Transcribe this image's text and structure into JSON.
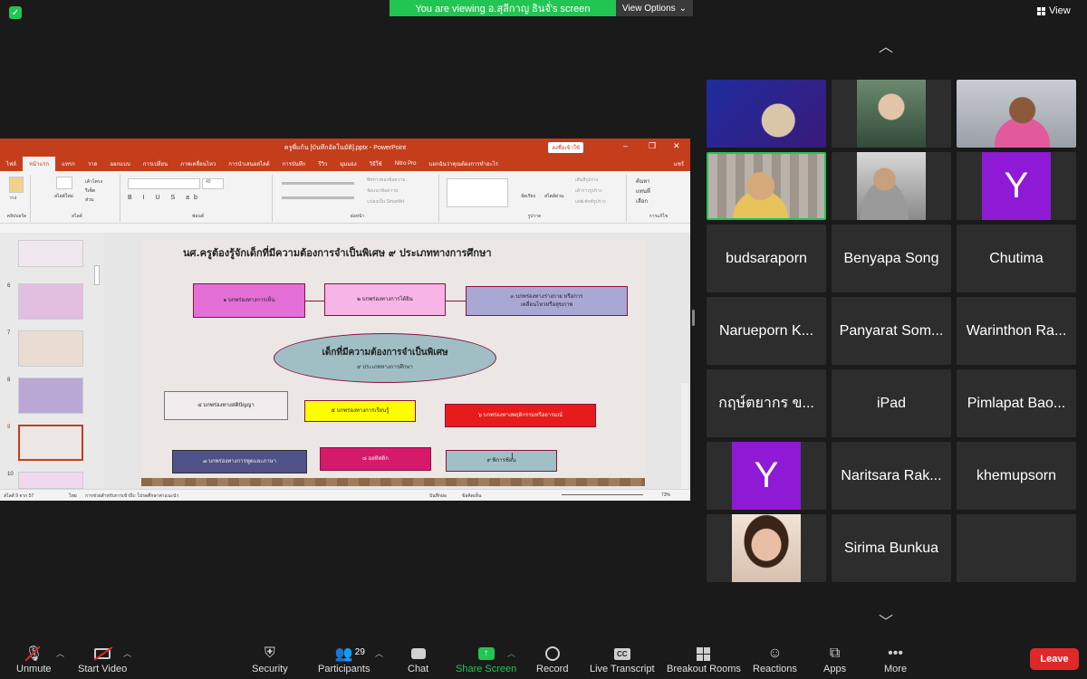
{
  "top": {
    "banner": "You are viewing อ.สุลีกาญ ธินจั่'s screen",
    "view_options": "View Options",
    "view": "View"
  },
  "ppt": {
    "title": "ครูพี่แก้น [บันทึกอัตโนมัติ].pptx - PowerPoint",
    "signin": "ลงชื่อเข้าใช้",
    "tabs": [
      "ไฟล์",
      "หน้าแรก",
      "แทรก",
      "วาด",
      "ออกแบบ",
      "การเปลี่ยน",
      "ภาพเคลื่อนไหว",
      "การนำเสนอสไลด์",
      "การบันทึก",
      "รีวิว",
      "มุมมอง",
      "วิธีใช้",
      "Nitro Pro",
      "บอกฉันว่าคุณต้องการทำอะไร",
      "แชร์"
    ],
    "active_tab_index": 1,
    "ribbon_groups": [
      "คลิปบอร์ด",
      "สไลด์",
      "ฟอนต์",
      "ย่อหน้า",
      "รูปวาด",
      "การแก้ไข"
    ],
    "ribbon_items": {
      "paste": "วาง",
      "new_slide": "สไลด์ใหม่",
      "layout": "เค้าโครง",
      "reset": "รีเซ็ต",
      "section": "ส่วน",
      "font_size": "40",
      "text_direction": "ทิศทางของข้อความ",
      "align_text": "จัดแนวข้อความ",
      "smartart": "แปลงเป็น SmartArt",
      "arrange": "จัดเรียง",
      "quick_styles": "สไตล์ด่วน",
      "shape_fill": "เติมสีรูปร่าง",
      "shape_outline": "เค้าร่างรูปร่าง",
      "shape_effects": "เอฟเฟกต์รูปร่าง",
      "find": "ค้นหา",
      "replace": "แทนที่",
      "select": "เลือก"
    },
    "thumb_numbers": [
      "6",
      "7",
      "8",
      "9",
      "10"
    ],
    "status": {
      "slide": "สไลด์ 9 จาก 57",
      "language": "ไทย",
      "accessibility": "การช่วยสำหรับการเข้าถึง: โปรดศึกษาค่าแนะนำ",
      "notes": "บันทึกย่อ",
      "comments": "ข้อคิดเห็น",
      "zoom": "73%"
    }
  },
  "slide": {
    "title": "นศ.ครูต้องรู้จักเด็กที่มีความต้องการจำเป็นพิเศษ ๙ ประเภททางการศึกษา",
    "center_main": "เด็กที่มีความต้องการจำเป็นพิเศษ",
    "center_sub": "๙ ประเภททางการศึกษา",
    "boxes": [
      {
        "text": "๑ บกพร่องทางการเห็น",
        "color": "#e46fd7"
      },
      {
        "text": "๒ บกพร่องทางการได้ยิน",
        "color": "#f7b4e6"
      },
      {
        "text": "๓ บกพร่องทางร่างกาย หรือการเคลื่อนไหวหรือสุขภาพ",
        "color": "#a9a8d4"
      },
      {
        "text": "๔ บกพร่องทางสติปัญญา",
        "color": "#f2ecee"
      },
      {
        "text": "๕ บกพร่องทางการเรียนรู้",
        "color": "#ffff00"
      },
      {
        "text": "๖ บกพร่องทางพฤติกรรมหรืออารมณ์",
        "color": "#e81b1b"
      },
      {
        "text": "๗ บกพร่องทางการพูดและภาษา",
        "color": "#4f5289"
      },
      {
        "text": "๘ ออทิสติก",
        "color": "#d61a6b"
      },
      {
        "text": "๙ พิการซ้อน",
        "color": "#a0c0c6"
      }
    ]
  },
  "gallery": {
    "names": [
      "budsaraporn",
      "Benyapa Song",
      "Chutima",
      "Narueporn K...",
      "Panyarat Som...",
      "Warinthon Ra...",
      "กฤษ์ตยากร ข...",
      "iPad",
      "Pimlapat Bao...",
      "Naritsara Rak...",
      "khemupsorn",
      "Sirima Bunkua"
    ],
    "avatar_letter": "Y"
  },
  "toolbar": {
    "unmute": "Unmute",
    "start_video": "Start Video",
    "security": "Security",
    "participants": "Participants",
    "participants_count": "29",
    "chat": "Chat",
    "share_screen": "Share Screen",
    "record": "Record",
    "live_transcript": "Live Transcript",
    "breakout_rooms": "Breakout Rooms",
    "reactions": "Reactions",
    "apps": "Apps",
    "more": "More",
    "leave": "Leave"
  }
}
